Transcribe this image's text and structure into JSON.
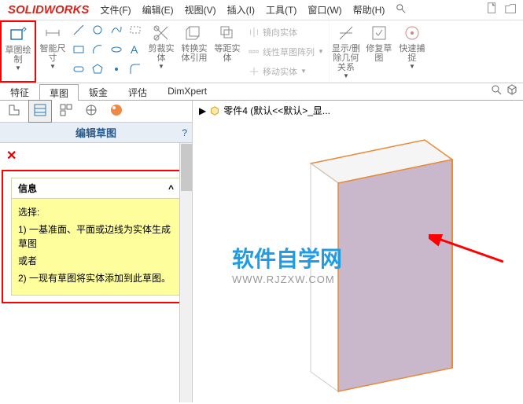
{
  "app": {
    "name": "SOLIDWORKS"
  },
  "menu": {
    "file": "文件(F)",
    "edit": "编辑(E)",
    "view": "视图(V)",
    "insert": "插入(I)",
    "tools": "工具(T)",
    "window": "窗口(W)",
    "help": "帮助(H)"
  },
  "ribbon": {
    "sketch": "草图绘\n制",
    "smartdim": "智能尺\n寸",
    "trim": "剪裁实\n体",
    "convert": "转换实\n体引用",
    "offset": "等距实\n体",
    "mirror": "镜向实体",
    "linear": "线性草图阵列",
    "move": "移动实体",
    "display": "显示/删\n除几何\n关系",
    "repair": "修复草\n图",
    "rapid": "快速捕\n捉"
  },
  "tabs": {
    "feature": "特征",
    "sketch": "草图",
    "sheetmetal": "钣金",
    "evaluate": "评估",
    "dimxpert": "DimXpert"
  },
  "panel": {
    "title": "编辑草图",
    "help": "?"
  },
  "info": {
    "header": "信息",
    "select": "选择:",
    "line1": "1) 一基准面、平面或边线为实体生成草图",
    "or": "或者",
    "line2": "2) 一现有草图将实体添加到此草图。",
    "chevron": "^"
  },
  "breadcrumb": {
    "arrow": "▶",
    "part": "零件4 (默认<<默认>_显..."
  },
  "watermark": {
    "cn": "软件自学网",
    "url": "WWW.RJZXW.COM"
  }
}
